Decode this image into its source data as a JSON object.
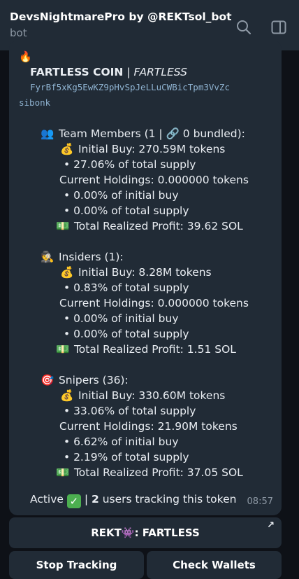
{
  "header": {
    "title": "DevsNightmarePro by @REKTsol_bot",
    "subtitle": "bot",
    "icons": [
      "search-icon",
      "side-panel-icon"
    ]
  },
  "message": {
    "fire": "🔥",
    "coin_name": "FARTLESS COIN",
    "sep": "|",
    "coin_ticker": "FARTLESS",
    "address_line1": "FyrBf5xKg5EwKZ9pHvSpJeLLuCWBicTpm3VvZc",
    "address_line2": "sibonk",
    "team": {
      "emoji": "👥",
      "heading": "Team Members (1 | 🔗 0 bundled):",
      "initial_emoji": "💰",
      "initial_buy": "Initial Buy: 270.59M tokens",
      "initial_pct": "• 27.06% of total supply",
      "holdings": "Current Holdings: 0.000000 tokens",
      "hold_initial": "• 0.00% of initial buy",
      "hold_supply": "• 0.00% of total supply",
      "profit_emoji": "💵",
      "profit": "Total Realized Profit: 39.62 SOL"
    },
    "insiders": {
      "emoji": "🕵️",
      "heading": "Insiders (1):",
      "initial_emoji": "💰",
      "initial_buy": "Initial Buy: 8.28M tokens",
      "initial_pct": "• 0.83% of total supply",
      "holdings": "Current Holdings: 0.000000 tokens",
      "hold_initial": "• 0.00% of initial buy",
      "hold_supply": "• 0.00% of total supply",
      "profit_emoji": "💵",
      "profit": "Total Realized Profit: 1.51 SOL"
    },
    "snipers": {
      "emoji": "🎯",
      "heading": "Snipers (36):",
      "initial_emoji": "💰",
      "initial_buy": "Initial Buy: 330.60M tokens",
      "initial_pct": "• 33.06% of total supply",
      "holdings": "Current Holdings: 21.90M tokens",
      "hold_initial": "• 6.62% of initial buy",
      "hold_supply": "• 2.19% of total supply",
      "profit_emoji": "💵",
      "profit": "Total Realized Profit: 37.05 SOL"
    },
    "status_active": "Active",
    "status_check": "✓",
    "status_sep": "|",
    "users_count": "2",
    "users_text": "users tracking this token",
    "time": "08:57"
  },
  "buttons": {
    "rekt_label": "REKT👾: FARTLESS",
    "rekt_arrow": "↗",
    "stop_label": "Stop Tracking",
    "check_label": "Check Wallets"
  }
}
